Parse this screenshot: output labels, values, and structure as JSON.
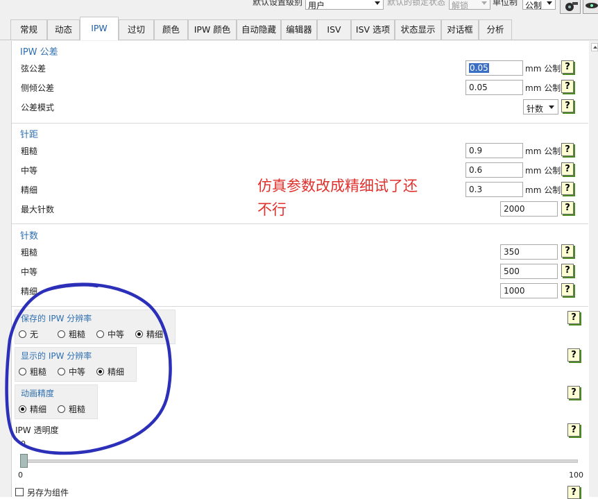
{
  "toolbar": {
    "default_level_label": "默认设置级别",
    "default_level_value": "用户",
    "default_lock_label": "默认的锁定状态",
    "default_lock_value": "解锁",
    "unit_label": "单位制",
    "unit_value": "公制"
  },
  "tabs": [
    "常规",
    "动态",
    "IPW",
    "过切",
    "颜色",
    "IPW 颜色",
    "自动隐藏",
    "编辑器",
    "ISV",
    "ISV 选项",
    "状态显示",
    "对话框",
    "分析"
  ],
  "active_tab": "IPW",
  "ipw_tolerance": {
    "title": "IPW 公差",
    "chord_label": "弦公差",
    "chord_value": "0.05",
    "tilt_label": "侧倾公差",
    "tilt_value": "0.05",
    "mode_label": "公差模式",
    "mode_value": "针数",
    "unit": "mm 公制"
  },
  "step": {
    "title": "针距",
    "coarse_label": "粗糙",
    "coarse_value": "0.9",
    "medium_label": "中等",
    "medium_value": "0.6",
    "fine_label": "精细",
    "fine_value": "0.3",
    "max_label": "最大针数",
    "max_value": "2000",
    "unit": "mm 公制"
  },
  "count": {
    "title": "针数",
    "coarse_label": "粗糙",
    "coarse_value": "350",
    "medium_label": "中等",
    "medium_value": "500",
    "fine_label": "精细",
    "fine_value": "1000"
  },
  "saved_resolution": {
    "title": "保存的 IPW 分辨率",
    "options": [
      "无",
      "粗糙",
      "中等",
      "精细"
    ],
    "selected": "精细"
  },
  "display_resolution": {
    "title": "显示的 IPW 分辨率",
    "options": [
      "粗糙",
      "中等",
      "精细"
    ],
    "selected": "精细"
  },
  "animation_precision": {
    "title": "动画精度",
    "options": [
      "精细",
      "粗糙"
    ],
    "selected": "精细"
  },
  "transparency": {
    "label": "IPW 透明度",
    "current": "0",
    "min": "0",
    "max": "100",
    "value_fraction": 0
  },
  "save_as_component": "另存为组件",
  "help_glyph": "?",
  "annotation": {
    "line1": "仿真参数改成精细试了还",
    "line2": "不行",
    "color": "#e0302c",
    "circle_color": "#2c2fb8"
  }
}
